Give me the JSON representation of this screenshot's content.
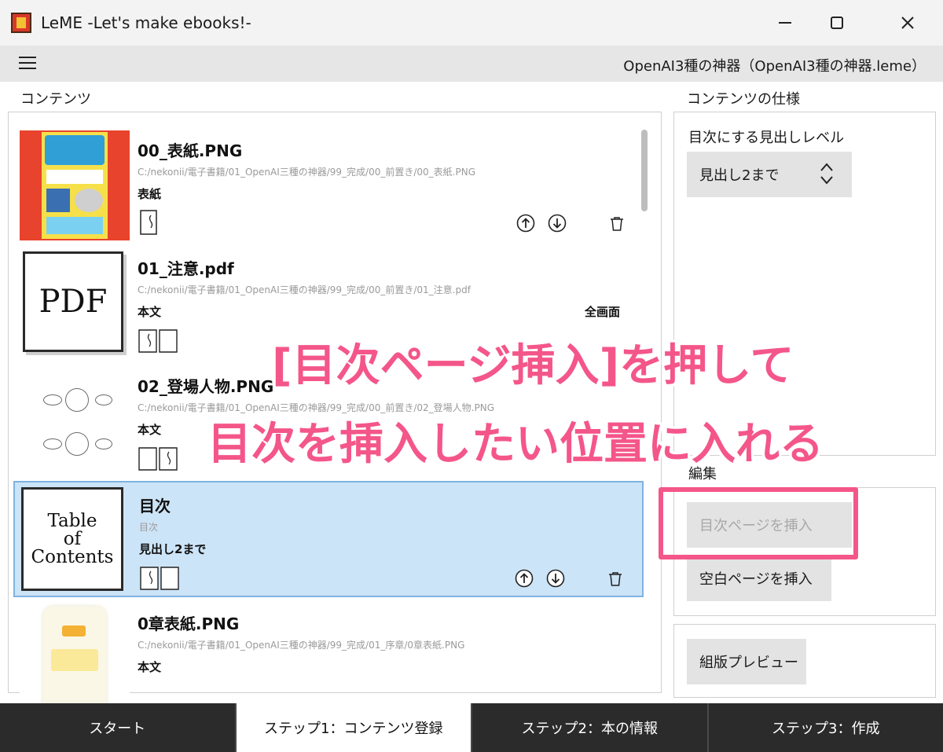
{
  "window": {
    "title": "LeME -Let's make ebooks!-",
    "minimize_label": "—",
    "maximize_label": "☐",
    "close_label": "✕"
  },
  "menubar": {
    "file_label": "OpenAI3種の神器（OpenAI3種の神器.leme）"
  },
  "contents": {
    "section_label": "コンテンツ",
    "fullscreen_label": "全画面",
    "items": [
      {
        "name": "00_表紙.PNG",
        "path": "C:/nekonii/電子書籍/01_OpenAI三種の神器/99_完成/00_前置き/00_表紙.PNG",
        "type": "表紙",
        "thumb": "cover",
        "icon": "single-page-icon"
      },
      {
        "name": "01_注意.pdf",
        "path": "C:/nekonii/電子書籍/01_OpenAI三種の神器/99_完成/00_前置き/01_注意.pdf",
        "type": "本文",
        "thumb": "pdf",
        "thumb_text": "PDF",
        "icon": "open-book-icon"
      },
      {
        "name": "02_登場人物.PNG",
        "path": "C:/nekonii/電子書籍/01_OpenAI三種の神器/99_完成/00_前置き/02_登場人物.PNG",
        "type": "本文",
        "thumb": "characters",
        "icon": "open-book-icon"
      },
      {
        "name": "目次",
        "path": "目次",
        "type": "見出し2まで",
        "thumb": "toc",
        "thumb_text_1": "Table",
        "thumb_text_2": "of",
        "thumb_text_3": "Contents",
        "icon": "open-book-icon",
        "selected": true
      },
      {
        "name": "0章表紙.PNG",
        "path": "C:/nekonii/電子書籍/01_OpenAI三種の神器/99_完成/01_序章/0章表紙.PNG",
        "type": "本文",
        "thumb": "chapter",
        "icon": "open-book-icon"
      }
    ]
  },
  "spec": {
    "section_label": "コンテンツの仕様",
    "toc_level_label": "目次にする見出しレベル",
    "toc_level_value": "見出し2まで"
  },
  "edit": {
    "section_label": "編集",
    "insert_toc_label": "目次ページを挿入",
    "insert_blank_label": "空白ページを挿入"
  },
  "preview": {
    "button_label": "組版プレビュー"
  },
  "annotation": {
    "line1": "[目次ページ挿入]を押して",
    "line2": "目次を挿入したい位置に入れる"
  },
  "tabs": [
    {
      "label": "スタート",
      "active": false
    },
    {
      "label": "ステップ1：コンテンツ登録",
      "active": true
    },
    {
      "label": "ステップ2：本の情報",
      "active": false
    },
    {
      "label": "ステップ3：作成",
      "active": false
    }
  ],
  "colors": {
    "accent_highlight": "#f4568a",
    "selected_row": "#cce4f7",
    "tab_dark": "#2b2b2b"
  }
}
